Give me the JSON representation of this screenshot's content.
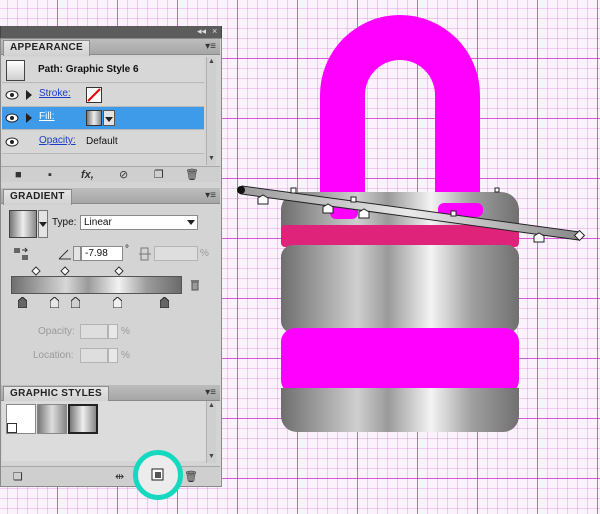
{
  "dock": {
    "collapse_glyph": "◂◂",
    "close_glyph": "×"
  },
  "appearance": {
    "tab": "APPEARANCE",
    "menu_glyph": "▾≡",
    "header_title": "Path: Graphic Style 6",
    "rows": {
      "stroke": {
        "label": "Stroke:",
        "swatch": "none"
      },
      "fill": {
        "label": "Fill:",
        "selected": true,
        "swatch": "gradient"
      },
      "opacity": {
        "label": "Opacity:",
        "value": "Default"
      }
    },
    "toolbar": [
      "square-icon",
      "new-fill-icon",
      "fx-icon",
      "clear-icon",
      "duplicate-icon",
      "trash-icon"
    ],
    "fx_glyph": "fx,"
  },
  "gradient": {
    "tab": "GRADIENT",
    "menu_glyph": "▾≡",
    "type_label": "Type:",
    "type_value": "Linear",
    "angle_value": "-7.98",
    "degree_symbol": "°",
    "percent_symbol": "%",
    "opacity_label": "Opacity:",
    "location_label": "Location:"
  },
  "graphic_styles": {
    "tab": "GRAPHIC STYLES",
    "menu_glyph": "▾≡"
  },
  "colors": {
    "lock_magenta": "#ff00ff",
    "lock_pink_band": "#e0237a",
    "highlight_ring": "#14d9c0",
    "selection_blue": "#3d9be9"
  }
}
